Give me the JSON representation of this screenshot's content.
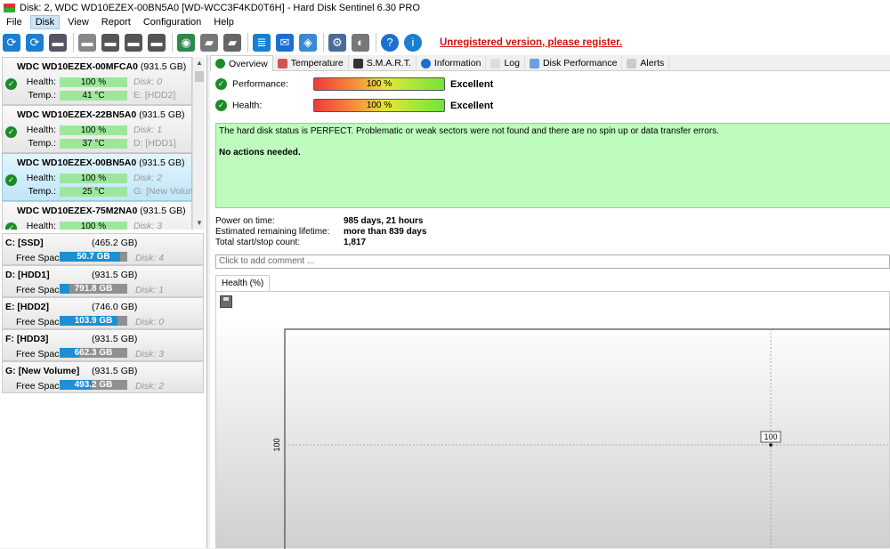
{
  "window": {
    "title": "Disk: 2, WDC WD10EZEX-00BN5A0 [WD-WCC3F4KD0T6H]  -  Hard Disk Sentinel 6.30 PRO"
  },
  "menu": [
    "File",
    "Disk",
    "View",
    "Report",
    "Configuration",
    "Help"
  ],
  "toolbar": {
    "icons": [
      "refresh-icon",
      "refresh-warning-icon",
      "disk-list-icon",
      "disk-gray-icon",
      "disk-clock-icon",
      "disk-check-icon",
      "disk-search-icon",
      "globe-disk-icon",
      "disk-tools-icon",
      "disk-transfer-icon",
      "report-icon",
      "mail-icon",
      "network-icon",
      "gear-icon",
      "speaker-icon",
      "help-icon",
      "info-icon"
    ],
    "unregistered": "Unregistered version, please register."
  },
  "disks": [
    {
      "name": "WDC WD10EZEX-00MFCA0",
      "size": "(931.5 GB)",
      "health_label": "Health:",
      "health": "100 %",
      "temp_label": "Temp.:",
      "temp": "41 °C",
      "disk": "Disk: 0",
      "volume": "E: [HDD2]"
    },
    {
      "name": "WDC WD10EZEX-22BN5A0",
      "size": "(931.5 GB)",
      "health_label": "Health:",
      "health": "100 %",
      "temp_label": "Temp.:",
      "temp": "37 °C",
      "disk": "Disk: 1",
      "volume": "D: [HDD1]"
    },
    {
      "name": "WDC WD10EZEX-00BN5A0",
      "size": "(931.5 GB)",
      "health_label": "Health:",
      "health": "100 %",
      "temp_label": "Temp.:",
      "temp": "25 °C",
      "disk": "Disk: 2",
      "volume": "G: [New Volume]"
    },
    {
      "name": "WDC WD10EZEX-75M2NA0",
      "size": "(931.5 GB)",
      "health_label": "Health:",
      "health": "100 %",
      "temp_label": "Temp.:",
      "temp": "",
      "disk": "Disk: 3",
      "volume": ""
    }
  ],
  "drives": [
    {
      "name": "C: [SSD]",
      "size": "(465.2 GB)",
      "free_label": "Free Space",
      "free": "50.7 GB",
      "free_pct": 89,
      "disk": "Disk: 4"
    },
    {
      "name": "D: [HDD1]",
      "size": "(931.5 GB)",
      "free_label": "Free Space",
      "free": "791.8 GB",
      "free_pct": 15,
      "disk": "Disk: 1"
    },
    {
      "name": "E: [HDD2]",
      "size": "(746.0 GB)",
      "free_label": "Free Space",
      "free": "103.9 GB",
      "free_pct": 86,
      "disk": "Disk: 0"
    },
    {
      "name": "F: [HDD3]",
      "size": "(931.5 GB)",
      "free_label": "Free Space",
      "free": "662.3 GB",
      "free_pct": 29,
      "disk": "Disk: 3"
    },
    {
      "name": "G: [New Volume]",
      "size": "(931.5 GB)",
      "free_label": "Free Space",
      "free": "493.2 GB",
      "free_pct": 47,
      "disk": "Disk: 2"
    }
  ],
  "tabs": [
    {
      "label": "Overview",
      "icon": "check-icon",
      "color": "#1e8a2a"
    },
    {
      "label": "Temperature",
      "icon": "thermometer-icon",
      "color": "#c55"
    },
    {
      "label": "S.M.A.R.T.",
      "icon": "dash-icon",
      "color": "#333"
    },
    {
      "label": "Information",
      "icon": "info-icon",
      "color": "#1a6fd0"
    },
    {
      "label": "Log",
      "icon": "document-icon",
      "color": "#ddd"
    },
    {
      "label": "Disk Performance",
      "icon": "chart-icon",
      "color": "#6aa0e0"
    },
    {
      "label": "Alerts",
      "icon": "alerts-icon",
      "color": "#ccc"
    }
  ],
  "overview": {
    "performance": {
      "label": "Performance:",
      "value": "100 %",
      "rating": "Excellent"
    },
    "health": {
      "label": "Health:",
      "value": "100 %",
      "rating": "Excellent"
    },
    "status_text": "The hard disk status is PERFECT. Problematic or weak sectors were not found and there are no spin up or data transfer errors.",
    "actions": "No actions needed.",
    "info": [
      {
        "label": "Power on time:",
        "value": "985 days, 21 hours"
      },
      {
        "label": "Estimated remaining lifetime:",
        "value": "more than 839 days"
      },
      {
        "label": "Total start/stop count:",
        "value": "1,817"
      }
    ],
    "comment_placeholder": "Click to add comment ...",
    "chart_tab": "Health (%)"
  },
  "chart_data": {
    "type": "line",
    "title": "Health (%)",
    "ylabel": "",
    "y_ticks": [
      "100"
    ],
    "points": [
      {
        "y": 100,
        "label": "100"
      }
    ]
  }
}
